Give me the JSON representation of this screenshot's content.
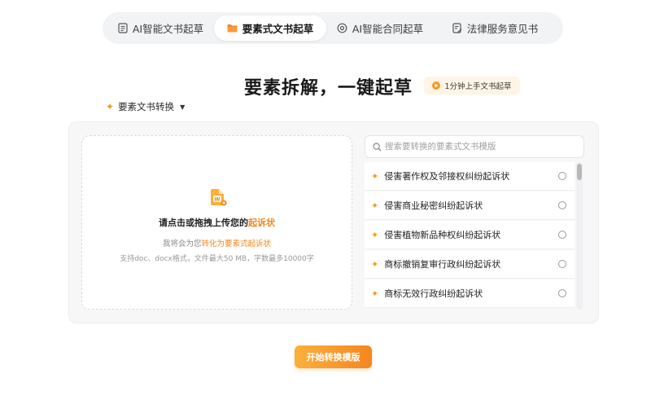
{
  "tabs": [
    {
      "label": "AI智能文书起草",
      "icon": "document-icon",
      "active": false
    },
    {
      "label": "要素式文书起草",
      "icon": "folder-icon",
      "active": true
    },
    {
      "label": "AI智能合同起草",
      "icon": "swirl-icon",
      "active": false
    },
    {
      "label": "法律服务意见书",
      "icon": "edit-document-icon",
      "active": false
    }
  ],
  "headline": "要素拆解，一键起草",
  "guide_button": {
    "label": "1分钟上手文书起草",
    "icon": "play-icon"
  },
  "selector": {
    "label": "要素文书转换",
    "icon": "sparkle-icon"
  },
  "upload": {
    "title_prefix": "请点击或拖拽上传您的",
    "title_highlight": "起诉状",
    "subtitle_prefix": "我将会为您",
    "subtitle_highlight": "转化为要素式起诉状",
    "note": "支持doc、docx格式，文件最大50 MB，字数最多10000字"
  },
  "search": {
    "placeholder": "搜索要转换的要素式文书模版"
  },
  "templates": [
    {
      "label": "侵害著作权及邻接权纠纷起诉状"
    },
    {
      "label": "侵害商业秘密纠纷起诉状"
    },
    {
      "label": "侵害植物新品种权纠纷起诉状"
    },
    {
      "label": "商标撤销复审行政纠纷起诉状"
    },
    {
      "label": "商标无效行政纠纷起诉状"
    }
  ],
  "start_button": {
    "label": "开始转换模版"
  },
  "colors": {
    "accent": "#f5861f",
    "accent_light": "#fbb03b",
    "panel_bg": "#f7f7f8",
    "tab_bg": "#f2f3f5"
  }
}
